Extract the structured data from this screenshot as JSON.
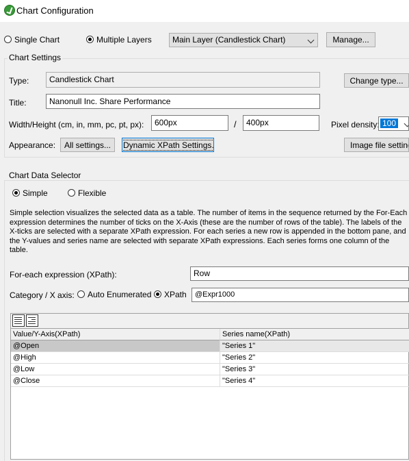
{
  "window": {
    "title": "Chart Configuration"
  },
  "mode": {
    "single_label": "Single Chart",
    "multiple_label": "Multiple Layers",
    "selected": "multiple"
  },
  "layer_select": {
    "value": "Main Layer (Candlestick Chart)"
  },
  "manage_button": "Manage...",
  "chart_settings": {
    "group_title": "Chart Settings",
    "type_label": "Type:",
    "type_value": "Candlestick Chart",
    "change_type_button": "Change type...",
    "title_label": "Title:",
    "title_value": "Nanonull Inc. Share Performance",
    "size_label": "Width/Height (cm, in, mm, pc, pt, px):",
    "width_value": "600px",
    "size_separator": "/",
    "height_value": "400px",
    "pixel_density_label": "Pixel density:",
    "pixel_density_value": "100",
    "appearance_label": "Appearance:",
    "all_settings_button": "All settings...",
    "dynamic_xpath_button": "Dynamic XPath Settings...",
    "image_file_settings_button": "Image file settings..."
  },
  "data_selector": {
    "group_title": "Chart Data Selector",
    "simple_label": "Simple",
    "flexible_label": "Flexible",
    "selected": "simple",
    "description": "Simple selection visualizes the selected data as a table. The number of items in the sequence returned by the For-Each expression determines the number of ticks on the X-Axis (these are the number of rows of the table). The labels of the X-ticks are selected with a separate XPath expression. For each series a new row is appended in the bottom pane, and the Y-values and series name are selected with separate XPath expressions. Each series forms one column of the table.",
    "foreach_label": "For-each expression (XPath):",
    "foreach_value": "Row",
    "category_label": "Category / X axis:",
    "auto_enumerated_label": "Auto Enumerated",
    "xpath_label": "XPath",
    "category_selected": "xpath",
    "xpath_value": "@Expr1000"
  },
  "series_grid": {
    "toolbar_icons": [
      "append-row-icon",
      "insert-row-icon"
    ],
    "headers": [
      "Value/Y-Axis(XPath)",
      "Series name(XPath)"
    ],
    "rows": [
      {
        "value": "@Open",
        "series": "\"Series 1\""
      },
      {
        "value": "@High",
        "series": "\"Series 2\""
      },
      {
        "value": "@Low",
        "series": "\"Series 3\""
      },
      {
        "value": "@Close",
        "series": "\"Series 4\""
      }
    ],
    "selected_row": 0
  },
  "colors": {
    "focus_border": "#0078d7",
    "selection_highlight": "#0078d7",
    "selected_row": "#c8c8c8"
  }
}
